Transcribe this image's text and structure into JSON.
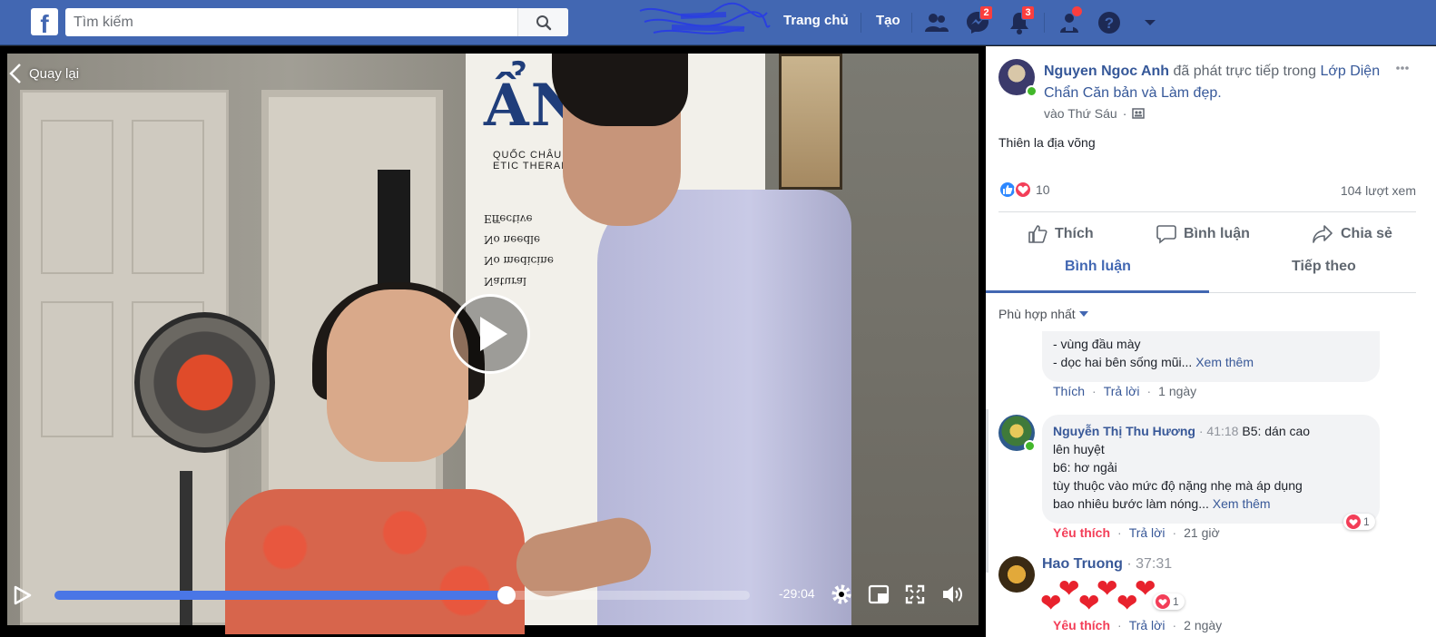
{
  "topbar": {
    "search_placeholder": "Tìm kiếm",
    "home_label": "Trang chủ",
    "create_label": "Tạo",
    "messenger_badge": "2",
    "notifications_badge": "3",
    "bg_color": "#4267b2"
  },
  "video": {
    "back_label": "Quay lại",
    "time_remaining": "-29:04",
    "progress_fraction": 0.65,
    "banner_title": "ẨN",
    "banner_subtitle": "QUỐC CHÂU",
    "banner_subtitle2": "ETIC THERAPY",
    "banner_list": [
      "Natural",
      "No medicine",
      "No needle",
      "Effective"
    ]
  },
  "post": {
    "author": "Nguyen Ngoc Anh",
    "action_text": "đã phát trực tiếp trong",
    "group": "Lớp Diện Chẩn Căn bản và Làm đẹp.",
    "when": "vào Thứ Sáu",
    "text": "Thiên la địa võng",
    "reaction_count": "10",
    "views": "104 lượt xem",
    "like_label": "Thích",
    "comment_label": "Bình luận",
    "share_label": "Chia sẻ",
    "tab_comments": "Bình luận",
    "tab_next": "Tiếp theo",
    "sort_label": "Phù hợp nhất"
  },
  "comments": [
    {
      "lines": [
        "- vùng đầu mày",
        "- dọc hai bên sống mũi..."
      ],
      "see_more": "Xem thêm",
      "like": "Thích",
      "reply": "Trả lời",
      "time": "1 ngày"
    },
    {
      "author": "Nguyễn Thị Thu Hương",
      "timestamp": "41:18",
      "lines": [
        "B5: dán cao",
        "lên huyệt",
        "b6: hơ ngải",
        "tùy thuộc vào mức độ nặng nhẹ mà áp dụng",
        "bao nhiêu bước làm nóng..."
      ],
      "see_more": "Xem thêm",
      "like": "Yêu thích",
      "reply": "Trả lời",
      "time": "21 giờ",
      "reaction_count": "1"
    },
    {
      "author": "Hao Truong",
      "timestamp": "37:31",
      "like": "Yêu thích",
      "reply": "Trả lời",
      "time": "2 ngày",
      "reaction_count": "1"
    }
  ]
}
